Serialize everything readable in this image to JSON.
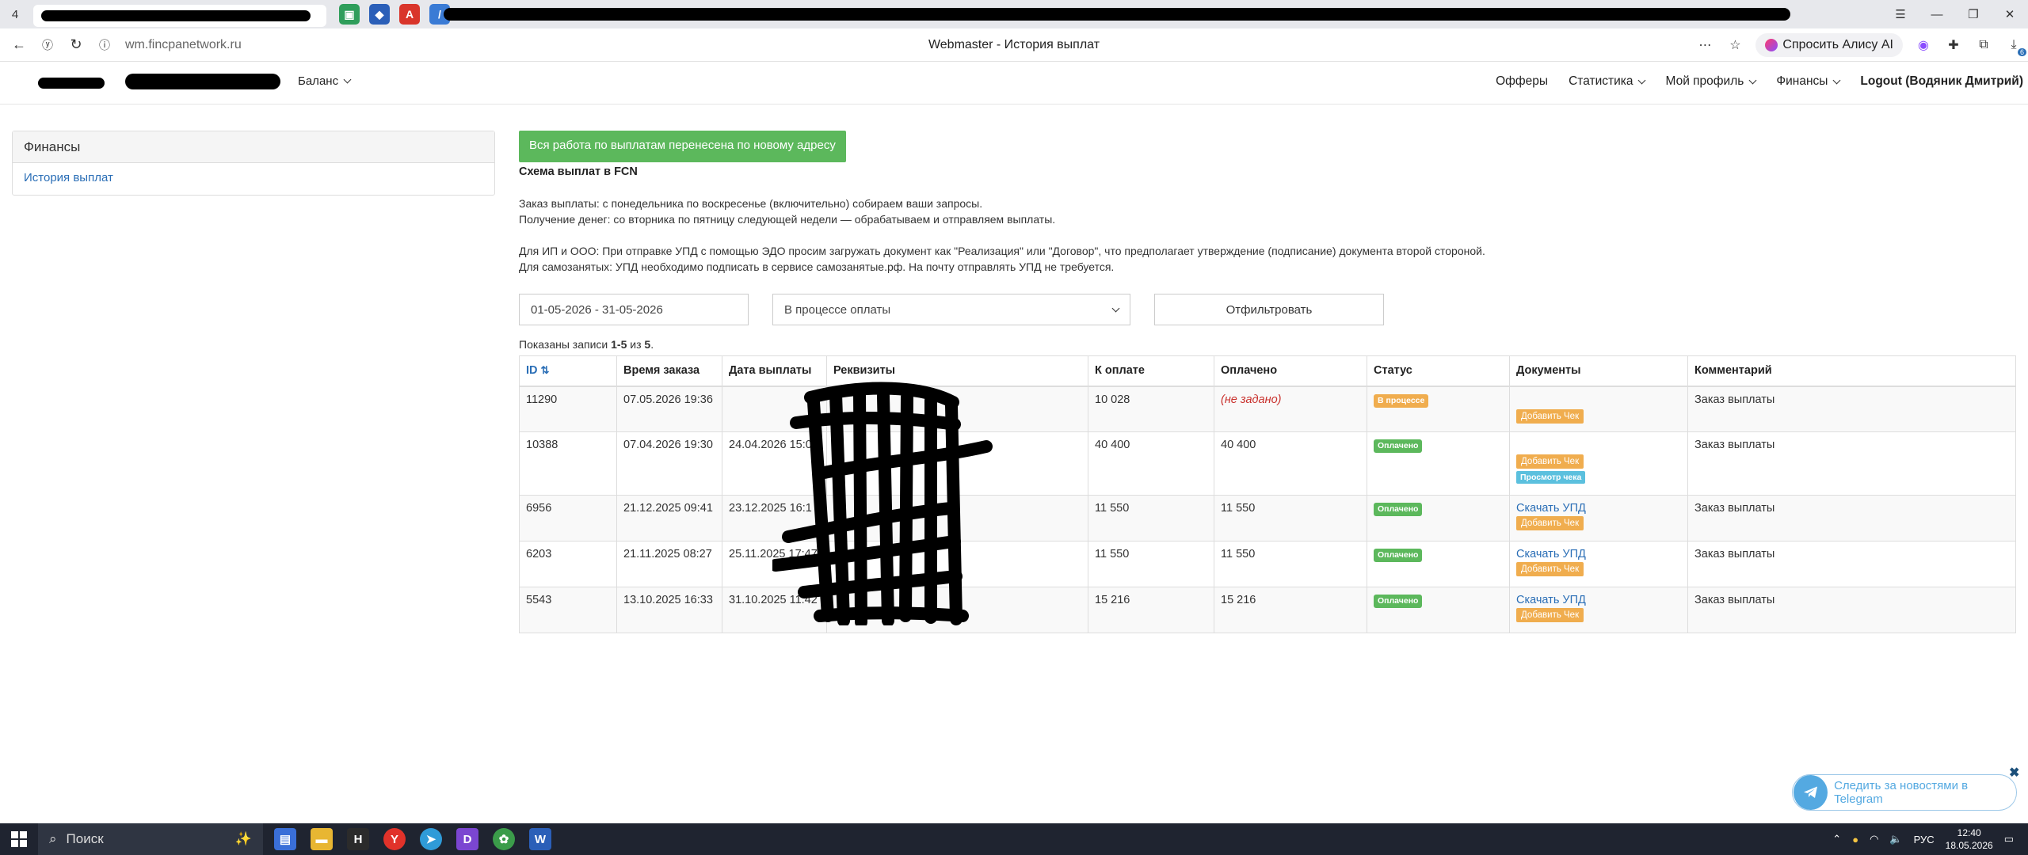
{
  "browser": {
    "tab_count": "4",
    "url": "wm.fincpanetwork.ru",
    "page_title": "Webmaster - История выплат",
    "alice_label": "Спросить Алису AI",
    "downloads_badge": "6"
  },
  "header": {
    "balance_label": "Баланс",
    "nav": [
      "Офферы",
      "Статистика",
      "Мой профиль",
      "Финансы",
      "Logout (Водяник Дмитрий)"
    ]
  },
  "sidebar": {
    "title": "Финансы",
    "items": [
      {
        "label": "История выплат"
      }
    ]
  },
  "main": {
    "notice_button": "Вся работа по выплатам перенесена по новому адресу",
    "scheme_title": "Схема выплат в FCN",
    "lines": [
      "Заказ выплаты: с понедельника по воскресенье (включительно) собираем ваши запросы.",
      "Получение денег: со вторника по пятницу следующей недели — обрабатываем и отправляем выплаты.",
      "Для ИП и ООО: При отправке УПД с помощью ЭДО просим загружать документ как \"Реализация\" или \"Договор\", что предполагает утверждение (подписание) документа второй стороной.",
      "Для самозанятых: УПД необходимо подписать в сервисе самозанятые.рф. На почту отправлять УПД не требуется."
    ],
    "filters": {
      "date_range": "01-05-2026 - 31-05-2026",
      "status_selected": "В процессе оплаты",
      "submit_label": "Отфильтровать"
    },
    "summary": {
      "prefix": "Показаны записи ",
      "range": "1-5",
      "of": " из ",
      "total": "5",
      "suffix": "."
    },
    "table": {
      "columns": [
        "ID",
        "Время заказа",
        "Дата выплаты",
        "Реквизиты",
        "К оплате",
        "Оплачено",
        "Статус",
        "Документы",
        "Комментарий"
      ],
      "rows": [
        {
          "id": "11290",
          "ordered": "07.05.2026 19:36",
          "paid_date": "",
          "requisites": "",
          "to_pay": "10 028",
          "paid": "(не задано)",
          "status": "В процессе",
          "docs": {
            "upd": "",
            "add": "Добавить Чек",
            "view": ""
          },
          "comment": "Заказ выплаты"
        },
        {
          "id": "10388",
          "ordered": "07.04.2026 19:30",
          "paid_date": "24.04.2026 15:04",
          "requisites": "",
          "to_pay": "40 400",
          "paid": "40 400",
          "status": "Оплачено",
          "docs": {
            "upd": "",
            "add": "Добавить Чек",
            "view": "Просмотр чека"
          },
          "comment": "Заказ выплаты"
        },
        {
          "id": "6956",
          "ordered": "21.12.2025 09:41",
          "paid_date": "23.12.2025 16:1",
          "requisites": "",
          "to_pay": "11 550",
          "paid": "11 550",
          "status": "Оплачено",
          "docs": {
            "upd": "Скачать УПД",
            "add": "Добавить Чек",
            "view": ""
          },
          "comment": "Заказ выплаты"
        },
        {
          "id": "6203",
          "ordered": "21.11.2025 08:27",
          "paid_date": "25.11.2025 17:47",
          "requisites": "",
          "to_pay": "11 550",
          "paid": "11 550",
          "status": "Оплачено",
          "docs": {
            "upd": "Скачать УПД",
            "add": "Добавить Чек",
            "view": ""
          },
          "comment": "Заказ выплаты"
        },
        {
          "id": "5543",
          "ordered": "13.10.2025 16:33",
          "paid_date": "31.10.2025 11:42",
          "requisites": "",
          "to_pay": "15 216",
          "paid": "15 216",
          "status": "Оплачено",
          "docs": {
            "upd": "Скачать УПД",
            "add": "Добавить Чек",
            "view": ""
          },
          "comment": "Заказ выплаты"
        }
      ]
    }
  },
  "telegram": {
    "label": "Следить за новостями в Telegram"
  },
  "taskbar": {
    "search_label": "Поиск",
    "lang": "РУС",
    "time": "12:40",
    "date": "18.05.2026"
  },
  "colors": {
    "accent_green": "#5cb85c",
    "badge_orange": "#f0ad4e",
    "badge_blue": "#5bc0de",
    "link_blue": "#2a6eb6",
    "telegram_blue": "#54a9e1"
  }
}
